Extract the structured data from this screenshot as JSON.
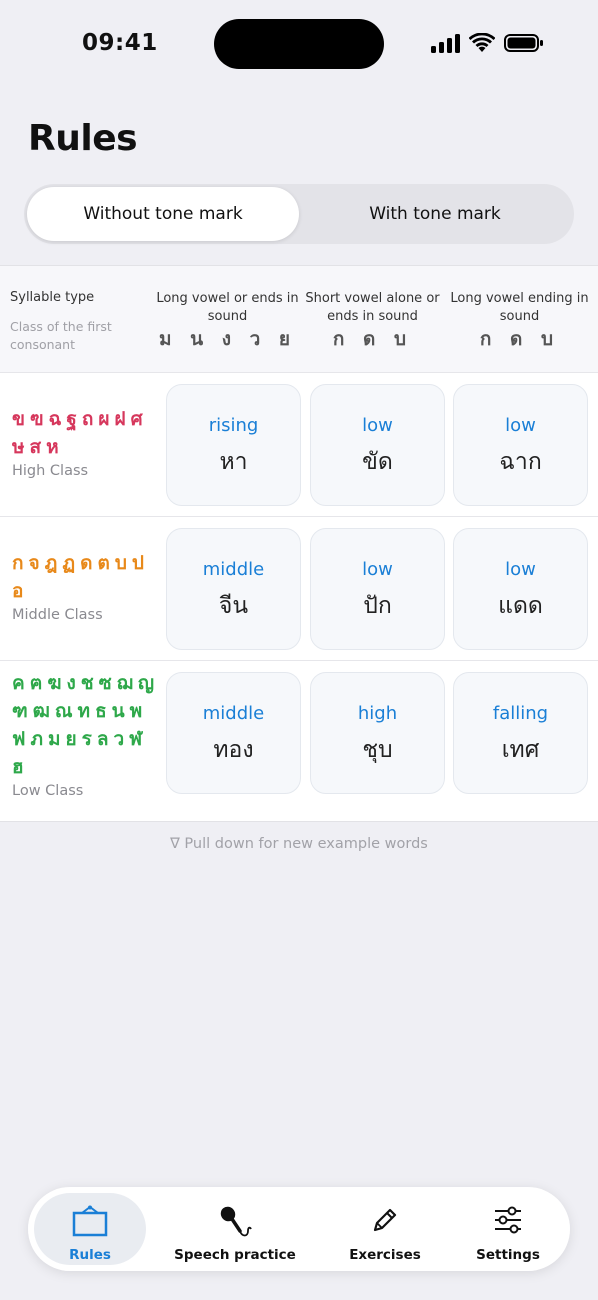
{
  "status": {
    "time": "09:41"
  },
  "title": "Rules",
  "segmented": {
    "options": [
      "Without tone mark",
      "With tone mark"
    ],
    "selected": "Without tone mark"
  },
  "table": {
    "header": {
      "syllable_type": "Syllable type",
      "class_label": "Class of the first consonant",
      "columns": [
        {
          "label": "Long vowel or ends in sound",
          "consonants": "ม น ง ว ย"
        },
        {
          "label": "Short vowel alone or ends in sound",
          "consonants": "ก ด บ"
        },
        {
          "label": "Long vowel ending in sound",
          "consonants": "ก ด บ"
        }
      ]
    },
    "rows": [
      {
        "letters": "ขฃฉฐถผฝศษสห",
        "class": "High Class",
        "color": "#d6375c",
        "cells": [
          {
            "tone": "rising",
            "word": "หา"
          },
          {
            "tone": "low",
            "word": "ขัด"
          },
          {
            "tone": "low",
            "word": "ฉาก"
          }
        ]
      },
      {
        "letters": "กจฎฏดตบปอ",
        "class": "Middle Class",
        "color": "#e8891a",
        "cells": [
          {
            "tone": "middle",
            "word": "จีน"
          },
          {
            "tone": "low",
            "word": "ปัก"
          },
          {
            "tone": "low",
            "word": "แดด"
          }
        ]
      },
      {
        "letters": "คฅฆงชซฌญฑฒณทธนพฟภมยรลวฬฮ",
        "class": "Low Class",
        "color": "#2ea84a",
        "cells": [
          {
            "tone": "middle",
            "word": "ทอง"
          },
          {
            "tone": "high",
            "word": "ชุบ"
          },
          {
            "tone": "falling",
            "word": "เทศ"
          }
        ]
      }
    ]
  },
  "hint": "∇ Pull down for new example words",
  "tabbar": {
    "items": [
      {
        "label": "Rules",
        "icon": "board-icon",
        "active": true
      },
      {
        "label": "Speech practice",
        "icon": "microphone-icon"
      },
      {
        "label": "Exercises",
        "icon": "pencil-icon"
      },
      {
        "label": "Settings",
        "icon": "sliders-icon"
      }
    ]
  },
  "colors": {
    "accent": "#1a7fd6",
    "high": "#d6375c",
    "middle": "#e8891a",
    "low": "#2ea84a"
  }
}
